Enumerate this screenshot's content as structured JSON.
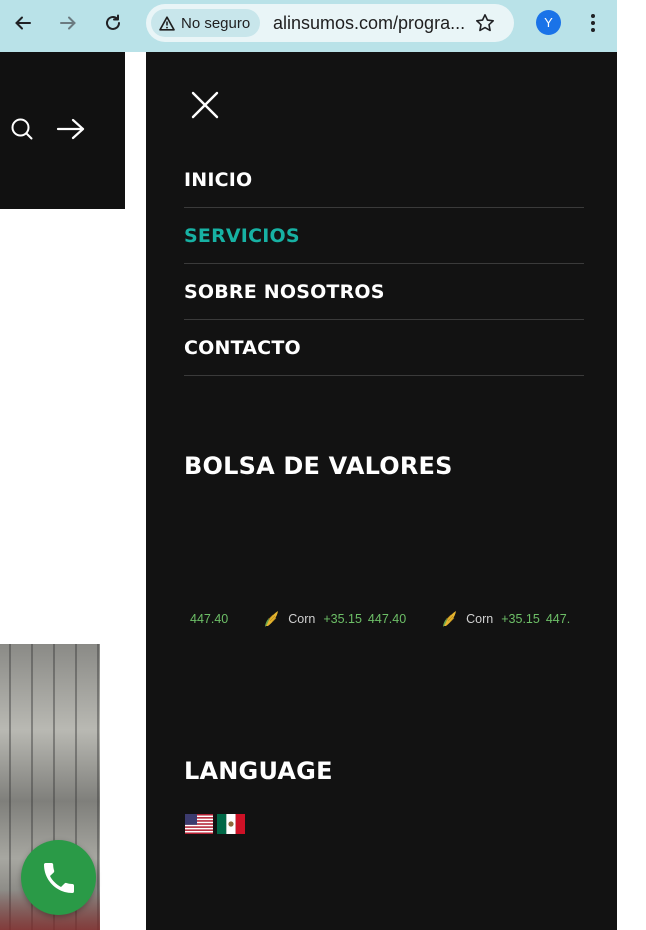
{
  "browser": {
    "security_label": "No seguro",
    "url": "alinsumos.com/progra...",
    "profile_initial": "Y"
  },
  "menu": {
    "items": [
      {
        "label": "INICIO",
        "active": false
      },
      {
        "label": "SERVICIOS",
        "active": true
      },
      {
        "label": "SOBRE NOSOTROS",
        "active": false
      },
      {
        "label": "CONTACTO",
        "active": false
      }
    ]
  },
  "stock": {
    "title": "BOLSA DE VALORES",
    "ticker": {
      "lead_price": "447.40",
      "items": [
        {
          "symbol": "Corn",
          "change": "+35.15",
          "price": "447.40"
        },
        {
          "symbol": "Corn",
          "change": "+35.15",
          "price": "447."
        }
      ]
    }
  },
  "language": {
    "title": "LANGUAGE",
    "flags": [
      "us-flag-icon",
      "mexico-flag-icon"
    ]
  },
  "colors": {
    "accent": "#17b1a3",
    "drawer_bg": "#121212",
    "ticker_green": "#6dbf67",
    "call_green": "#2a9a47"
  }
}
